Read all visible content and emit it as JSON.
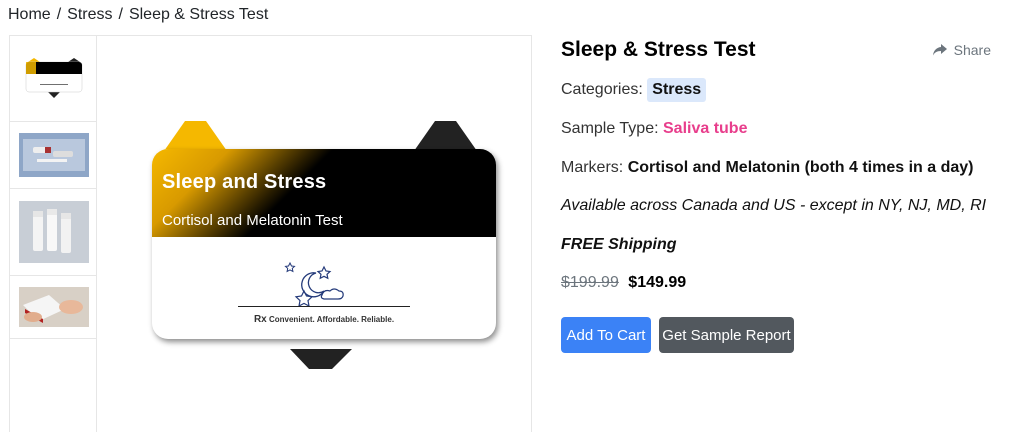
{
  "breadcrumb": {
    "home": "Home",
    "sep1": "/",
    "stress": "Stress",
    "sep2": "/",
    "current": "Sleep & Stress Test"
  },
  "gallery": {
    "card_title": "Sleep and Stress",
    "card_subtitle": "Cortisol and Melatonin Test",
    "card_rx_symbol": "Rx",
    "card_tagline": "Convenient. Affordable. Reliable."
  },
  "product": {
    "title": "Sleep & Stress Test",
    "share_label": "Share",
    "categories_label": "Categories:",
    "category": "Stress",
    "sample_label": "Sample Type:",
    "sample_type": "Saliva tube",
    "markers_label": "Markers:",
    "markers": "Cortisol and Melatonin (both 4 times in a day)",
    "availability": "Available across Canada and US - except in NY, NJ, MD, RI",
    "shipping": "FREE Shipping",
    "old_price": "$199.99",
    "price": "$149.99",
    "add_to_cart": "Add To Cart",
    "sample_report": "Get Sample Report"
  },
  "colors": {
    "primary": "#3b82f6",
    "secondary": "#52585e",
    "accent_pink": "#e83e8c",
    "tag_bg": "#dbe8fb",
    "gold": "#f5b800"
  }
}
